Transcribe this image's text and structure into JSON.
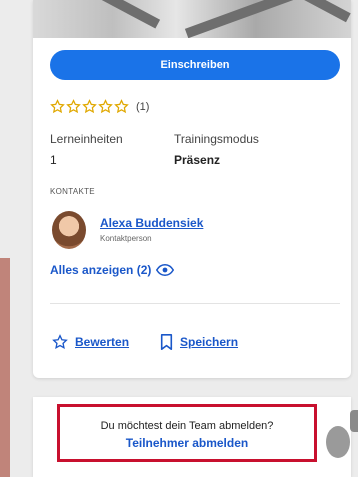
{
  "course_card": {
    "enroll_label": "Einschreiben",
    "rating": {
      "stars_filled": 0,
      "stars_total": 5,
      "count_text": "(1)"
    },
    "meta": [
      {
        "label": "Lerneinheiten",
        "value": "1"
      },
      {
        "label": "Trainingsmodus",
        "value": "Präsenz"
      }
    ],
    "contacts_heading": "KONTAKTE",
    "contact": {
      "name": "Alexa Buddensiek",
      "role": "Kontaktperson"
    },
    "show_all_label": "Alles anzeigen (2)",
    "actions": {
      "rate_label": "Bewerten",
      "save_label": "Speichern"
    }
  },
  "team_unsubscribe": {
    "question": "Du möchtest dein Team abmelden?",
    "link_label": "Teilnehmer abmelden"
  },
  "colors": {
    "accent": "#1a73e8",
    "link": "#1a57c9",
    "highlight_border": "#c8102e",
    "star": "#e0a800"
  }
}
